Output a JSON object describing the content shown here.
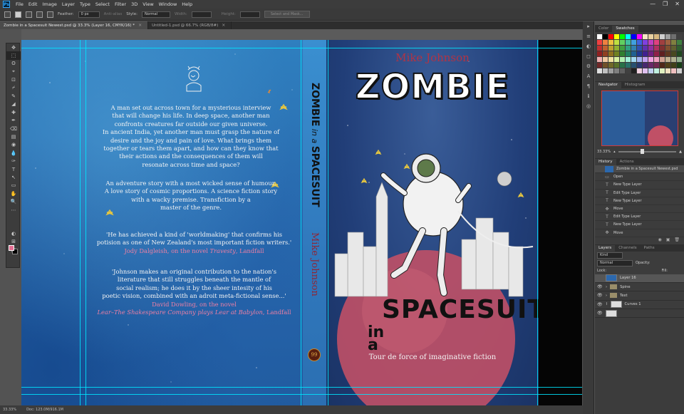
{
  "app": {
    "logo": "Ps"
  },
  "menu": [
    "File",
    "Edit",
    "Image",
    "Layer",
    "Type",
    "Select",
    "Filter",
    "3D",
    "View",
    "Window",
    "Help"
  ],
  "window_controls": [
    "—",
    "❐",
    "✕"
  ],
  "options": {
    "feather_label": "Feather:",
    "feather_value": "0 px",
    "antialias_label": "Anti-alias",
    "style_label": "Style:",
    "style_value": "Normal",
    "width_label": "Width:",
    "height_label": "Height:",
    "select_mask": "Select and Mask..."
  },
  "tabs": [
    {
      "label": "Zombie in a Spacesuit Newest.psd @ 33.3% (Layer 16, CMYK/16) *",
      "close": "×"
    },
    {
      "label": "Untitled-1.psd @ 66.7% (RGB/8#)",
      "close": "×"
    }
  ],
  "tools": [
    "✥",
    "⬚",
    "ʘ",
    "⌖",
    "⊡",
    "⌿",
    "✎",
    "◢",
    "✚",
    "✒",
    "⌫",
    "▤",
    "◉",
    "💧",
    "✑",
    "T",
    "↖",
    "▭",
    "✋",
    "🔍",
    "⋯",
    "◐",
    "⊞",
    "▣"
  ],
  "back_cover": {
    "blurb_lines": [
      "A man set out across town for a mysterious interview",
      "that will change his life. In deep space, another man",
      "confronts creatures far outside our given universe.",
      "In ancient India, yet another man must grasp the nature of",
      "desire and the joy and pain of love. What brings them",
      "together or tears them apart, and how can they know that",
      "their actions and the consequences of them will",
      "resonate across time and space?"
    ],
    "blurb2_lines": [
      "An adventure story with a most wicked sense of humour.",
      "A love story of cosmic proportions. A science fiction story",
      "with a wacky premise. Transfiction by a",
      "master of the genre."
    ],
    "quote1_lines": [
      "'He has achieved a kind of 'worldmaking' that confirms his",
      "potision as one of New Zealand's most important fiction writers.'"
    ],
    "quote1_attr_pre": "Jody Dalgleish, on the novel ",
    "quote1_attr_title": "Travesty",
    "quote1_attr_post": ", Landfall",
    "quote2_lines": [
      "'Johnson makes an original contribution to the nation's",
      "literature that still struggles beneath the mantle of",
      "social realism; he does it by the sheer intesity of his",
      "poetic vision, combined with an adroit meta-fictional sense...'"
    ],
    "quote2_attr1": "David Dowling, on the novel",
    "quote2_attr2_title": "Lear–The Shakespeare Company plays Lear at Babylon",
    "quote2_attr2_post": ", Landfall"
  },
  "spine": {
    "title_a": "ZOMBIE",
    "title_b": " in a ",
    "title_c": "SPACESUIT",
    "author": "Mike Johnson",
    "badge": "99"
  },
  "front_cover": {
    "author": "Mike Johnson",
    "title_top": "ZOMBIE",
    "title_in": "in",
    "title_a": "a",
    "title_bottom": "SPACESUIT",
    "tagline": "Tour de force of imaginative fiction"
  },
  "panel_icons": [
    "▸",
    "≡",
    "◐",
    "◻",
    "⚙",
    "A",
    "¶",
    "ℹ",
    "◎"
  ],
  "swatches_tabs": [
    "Color",
    "Swatches"
  ],
  "swatch_colors": [
    "#ffffff",
    "#000000",
    "#ff0000",
    "#ffff00",
    "#00ff00",
    "#00ffff",
    "#0000ff",
    "#ff00ff",
    "#f6e6c4",
    "#e8d0a0",
    "#d8b880",
    "#cfcfcf",
    "#9f9f9f",
    "#6f6f6f",
    "#3f3f3f",
    "#f04040",
    "#f08040",
    "#f0c040",
    "#c0e040",
    "#60d060",
    "#40c0a0",
    "#40a0e0",
    "#4060e0",
    "#8040e0",
    "#c040c0",
    "#e04080",
    "#a04040",
    "#a06040",
    "#808040",
    "#408040",
    "#c03030",
    "#c06030",
    "#c0a030",
    "#90b030",
    "#40a040",
    "#30a080",
    "#3080b0",
    "#3050b0",
    "#6030b0",
    "#9030a0",
    "#b03060",
    "#803030",
    "#805030",
    "#606030",
    "#306030",
    "#902020",
    "#904020",
    "#907020",
    "#708020",
    "#308030",
    "#208060",
    "#206090",
    "#203890",
    "#402090",
    "#702080",
    "#902048",
    "#602020",
    "#603820",
    "#484820",
    "#204820",
    "#f0b0b0",
    "#f0c8a0",
    "#f0e0a0",
    "#d8f0a0",
    "#b0f0b0",
    "#a0f0d8",
    "#a0d8f0",
    "#a0b0f0",
    "#c0a0f0",
    "#f0a0e0",
    "#f0a0c0",
    "#d0a090",
    "#c0b090",
    "#b0b090",
    "#90b090",
    "#702828",
    "#705028",
    "#706828",
    "#587028",
    "#287048",
    "#287068",
    "#285070",
    "#283870",
    "#482870",
    "#682868",
    "#702850",
    "#502818",
    "#504018",
    "#404018",
    "#184018",
    "#e0e0e0",
    "#c0c0c0",
    "#a0a0a0",
    "#808080",
    "#606060",
    "#404040",
    "#202020",
    "#f0d0e0",
    "#e0c0f0",
    "#c0d0f0",
    "#c0f0e0",
    "#e0f0c0",
    "#f0e0c0",
    "#f0c0c0",
    "#d0d0d0"
  ],
  "navigator": {
    "tabs": [
      "Navigator",
      "Histogram"
    ],
    "zoom": "33.33%"
  },
  "history": {
    "tabs": [
      "History",
      "Actions"
    ],
    "doc": "Zombie in a Spacesuit Newest.psd",
    "items": [
      "Open",
      "New Type Layer",
      "Edit Type Layer",
      "New Type Layer",
      "Move",
      "Edit Type Layer",
      "New Type Layer",
      "Move"
    ]
  },
  "layers": {
    "tabs": [
      "Layers",
      "Channels",
      "Paths"
    ],
    "kind_label": "Kind",
    "blend_mode": "Normal",
    "opacity_label": "Opacity:",
    "lock_label": "Lock:",
    "fill_label": "Fill:",
    "items": [
      {
        "name": "Layer 16",
        "type": "pixel"
      },
      {
        "name": "Spine",
        "type": "folder"
      },
      {
        "name": "Text",
        "type": "folder"
      },
      {
        "name": "Curves 1",
        "type": "adjust"
      },
      {
        "name": "",
        "type": "mask"
      }
    ]
  },
  "status": {
    "zoom": "33.33%",
    "doc": "Doc: 123.0M/916.1M"
  }
}
